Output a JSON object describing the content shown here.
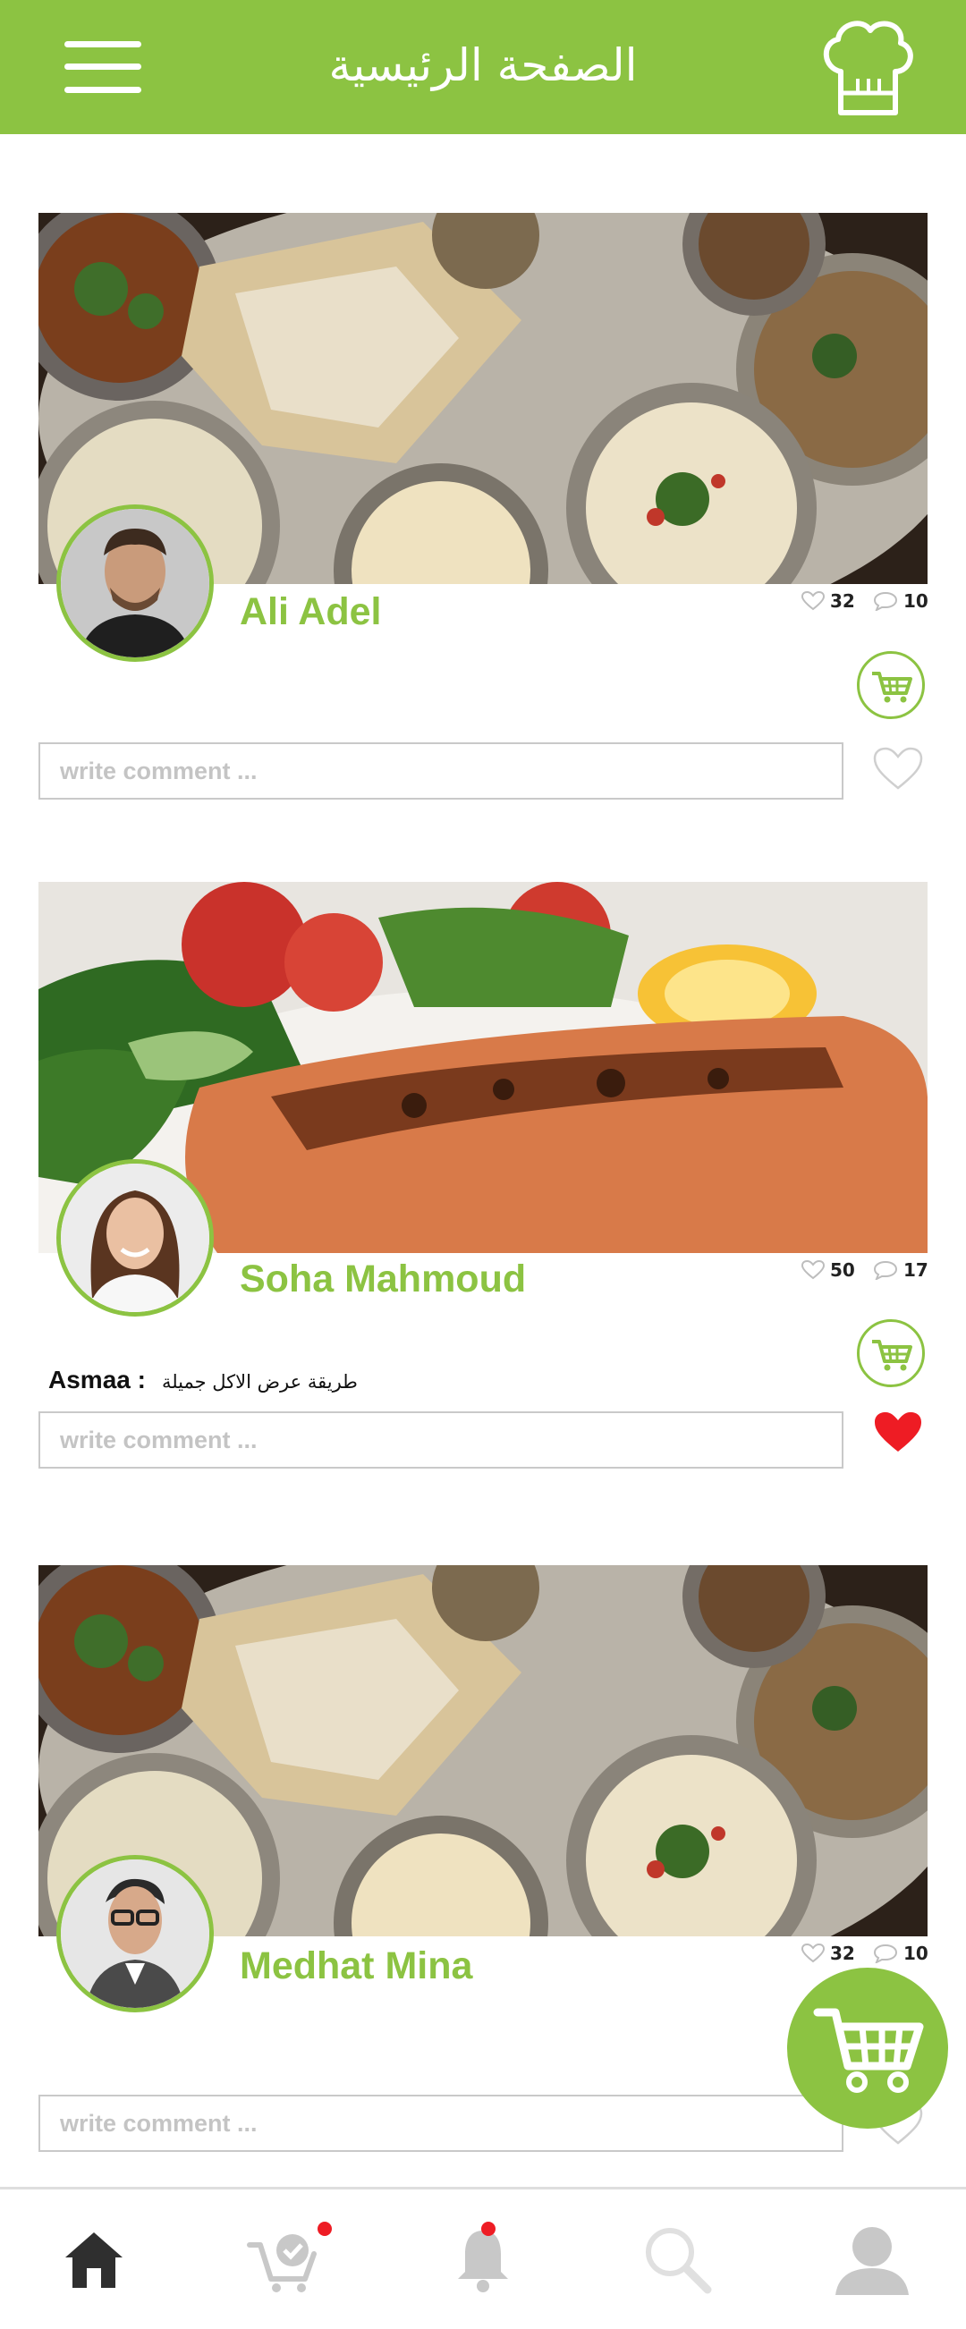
{
  "header": {
    "title": "الصفحة الرئيسية",
    "menu_icon": "hamburger-icon",
    "right_icon": "chef-hat-icon"
  },
  "posts": [
    {
      "author": "Ali Adel",
      "likes": "32",
      "comments": "10",
      "liked": false,
      "image": "indian-thali-food",
      "avatar": "man-beard",
      "comment_placeholder": "write comment ..."
    },
    {
      "author": "Soha Mahmoud",
      "likes": "50",
      "comments": "17",
      "liked": true,
      "image": "grilled-salmon-salad",
      "avatar": "woman-smiling",
      "comment_placeholder": "write comment ...",
      "latest_comment": {
        "user": "Asmaa :",
        "text": "طريقة عرض الاكل جميلة"
      }
    },
    {
      "author": "Medhat Mina",
      "likes": "32",
      "comments": "10",
      "liked": false,
      "image": "indian-thali-food",
      "avatar": "man-glasses",
      "comment_placeholder": "write comment ..."
    }
  ],
  "floating_action": {
    "icon": "cart-icon"
  },
  "bottom_nav": [
    {
      "name": "home",
      "icon": "home-icon",
      "active": true
    },
    {
      "name": "orders",
      "icon": "cart-check-icon",
      "badge": true
    },
    {
      "name": "notifications",
      "icon": "bell-icon",
      "badge": true
    },
    {
      "name": "search",
      "icon": "search-icon"
    },
    {
      "name": "profile",
      "icon": "user-icon"
    }
  ],
  "colors": {
    "primary": "#8cc342",
    "like_red": "#ee1c24",
    "inactive_icon": "#c8c8c8",
    "active_icon": "#2f2f2f"
  }
}
